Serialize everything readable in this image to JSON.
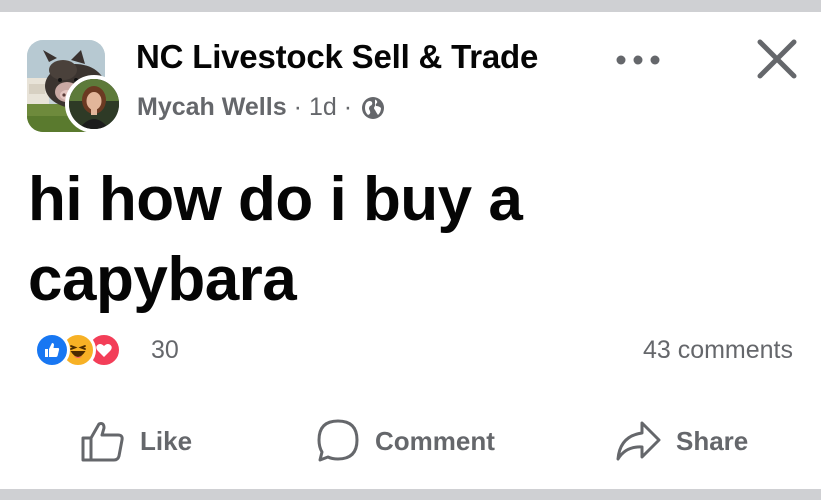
{
  "post": {
    "group_name": "NC Livestock Sell & Trade",
    "author": "Mycah Wells",
    "time": "1d",
    "separator": "·",
    "audience_icon": "globe-icon",
    "text_line1": "hi how do i buy a",
    "text_line2": "capybara"
  },
  "reactions": {
    "icons": [
      "like-reaction-icon",
      "haha-reaction-icon",
      "love-reaction-icon"
    ],
    "count": "30",
    "comments": "43 comments"
  },
  "actions": {
    "like_label": "Like",
    "comment_label": "Comment",
    "share_label": "Share"
  },
  "colors": {
    "text": "#050505",
    "secondary": "#65676b",
    "like_blue": "#1877f2",
    "love_red": "#f33e58",
    "haha_yellow": "#f7b125",
    "divider": "#cfd0d3"
  }
}
